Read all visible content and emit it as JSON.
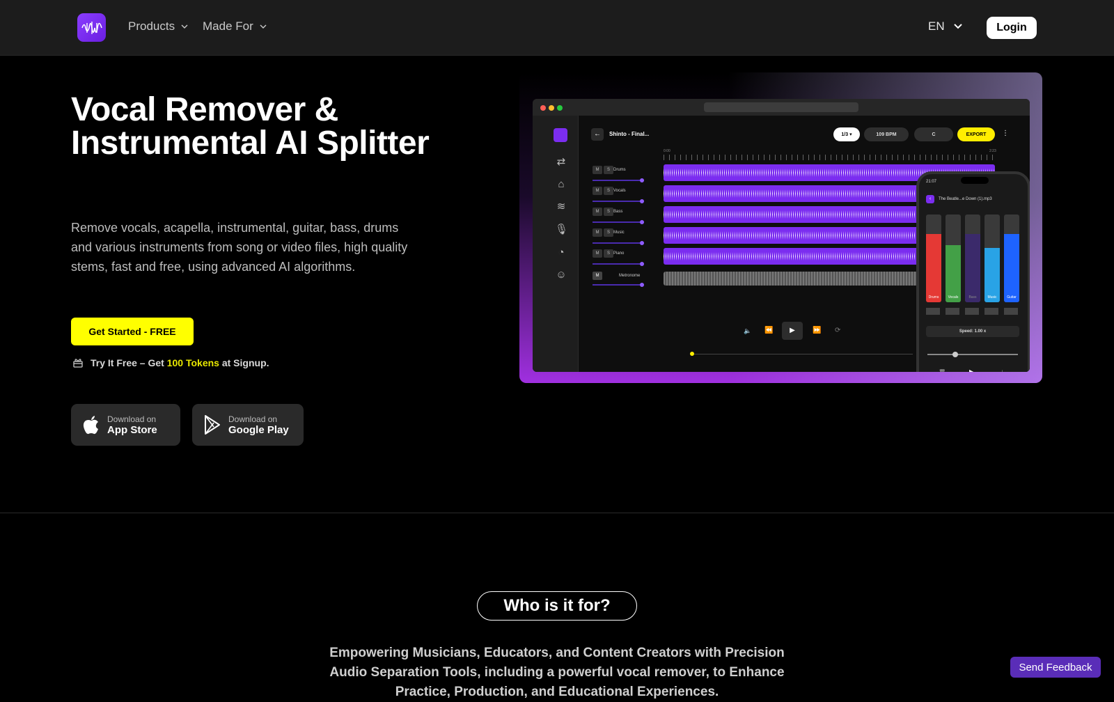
{
  "nav": {
    "products_label": "Products",
    "made_for_label": "Made For",
    "language": "EN",
    "login_label": "Login"
  },
  "hero": {
    "title": "Vocal Remover & Instrumental AI Splitter",
    "description": "Remove vocals, acapella, instrumental, guitar, bass, drums and various instruments from song or video files, high quality stems, fast and free, using advanced AI algorithms.",
    "cta_label": "Get Started - FREE",
    "tokens_prefix": "Try It Free – Get ",
    "tokens_highlight": "100 Tokens",
    "tokens_suffix": " at Signup.",
    "app_store_small": "Download on",
    "app_store_big": "App Store",
    "google_play_small": "Download on",
    "google_play_big": "Google Play"
  },
  "mockup": {
    "project_title": "Shinto - Final...",
    "bpm": "109 BPM",
    "key": "C",
    "export_label": "EXPORT",
    "time_start": "0:00",
    "time_end": "2:23",
    "tracks": [
      "Drums",
      "Vocals",
      "Bass",
      "Music",
      "Piano",
      "Metronome"
    ],
    "mute_label": "M",
    "solo_label": "S",
    "phone_time": "21:07",
    "phone_file": "The Beatle...e Down (1).mp3",
    "phone_stems": [
      "Drums",
      "Vocals",
      "Bass",
      "Music",
      "Guitar"
    ],
    "phone_speed": "Speed: 1.00 x",
    "colors": {
      "drums": "#e53935",
      "vocals": "#43a047",
      "bass": "#3b2a6b",
      "music": "#29a3e6",
      "guitar": "#1e63ff",
      "accent": "#7b2df0",
      "yellow": "#ffff00"
    }
  },
  "section": {
    "who_title": "Who is it for?",
    "who_description": "Empowering Musicians, Educators, and Content Creators with Precision Audio Separation Tools, including a powerful vocal remover, to Enhance Practice, Production, and Educational Experiences."
  },
  "feedback_label": "Send Feedback"
}
